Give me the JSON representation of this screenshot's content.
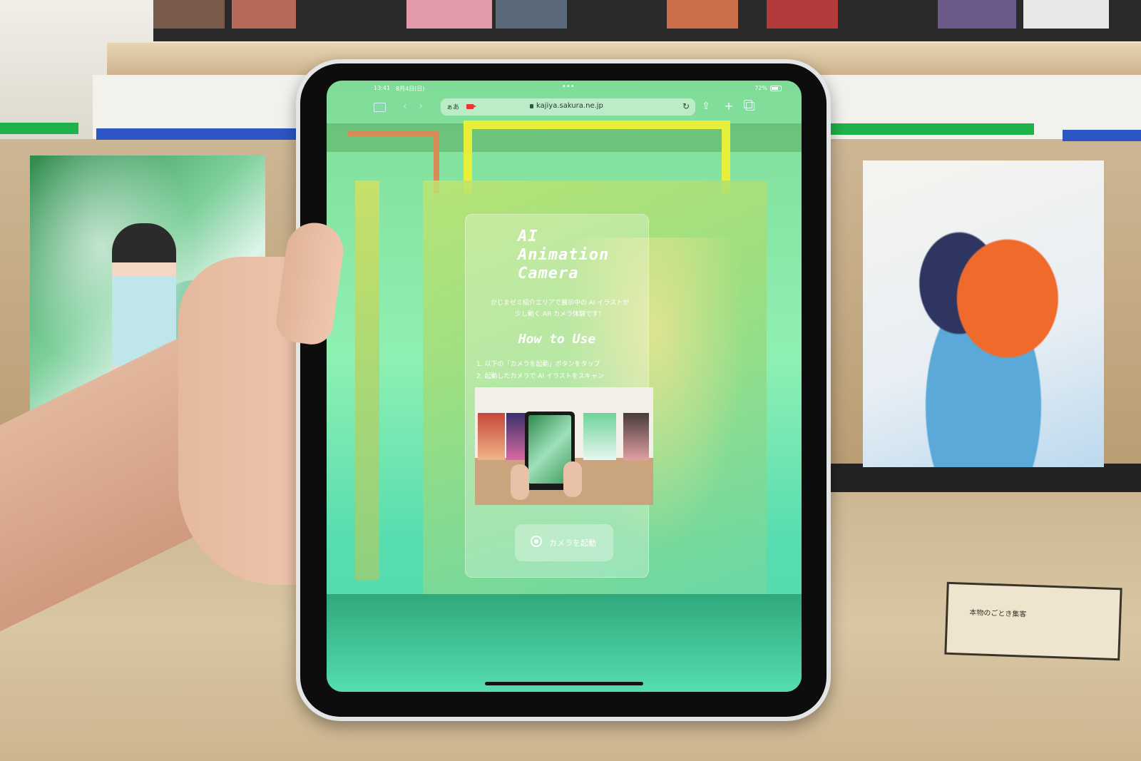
{
  "status_bar": {
    "time": "13:41",
    "date": "8月4日(日)",
    "dots": "•••",
    "battery": "72%"
  },
  "browser": {
    "text_size_label": "ぁあ",
    "url": "kajiya.sakura.ne.jp",
    "icons": [
      "sidebar-icon",
      "back-icon",
      "forward-icon",
      "record-icon",
      "lock-icon",
      "reload-icon",
      "share-icon",
      "new-tab-icon",
      "tabs-icon"
    ]
  },
  "page": {
    "logo_lines": [
      "AI",
      "Animation",
      "Camera"
    ],
    "description_lines": [
      "かじまゼミ紹介エリアで展示中の AI イラストが",
      "少し動く AR カメラ体験です！"
    ],
    "howto_title": "How to Use",
    "steps": [
      "1. 以下の「カメラを起動」ボタンをタップ",
      "2. 起動したカメラで AI イラストをスキャン"
    ],
    "camera_button_label": "カメラを起動"
  },
  "placard": {
    "title": "本物のごとき集客"
  },
  "colors": {
    "screen_green": "#8ff0b3",
    "accent_teal": "#4fd7ad",
    "tablet_body": "#e4e5e7"
  }
}
